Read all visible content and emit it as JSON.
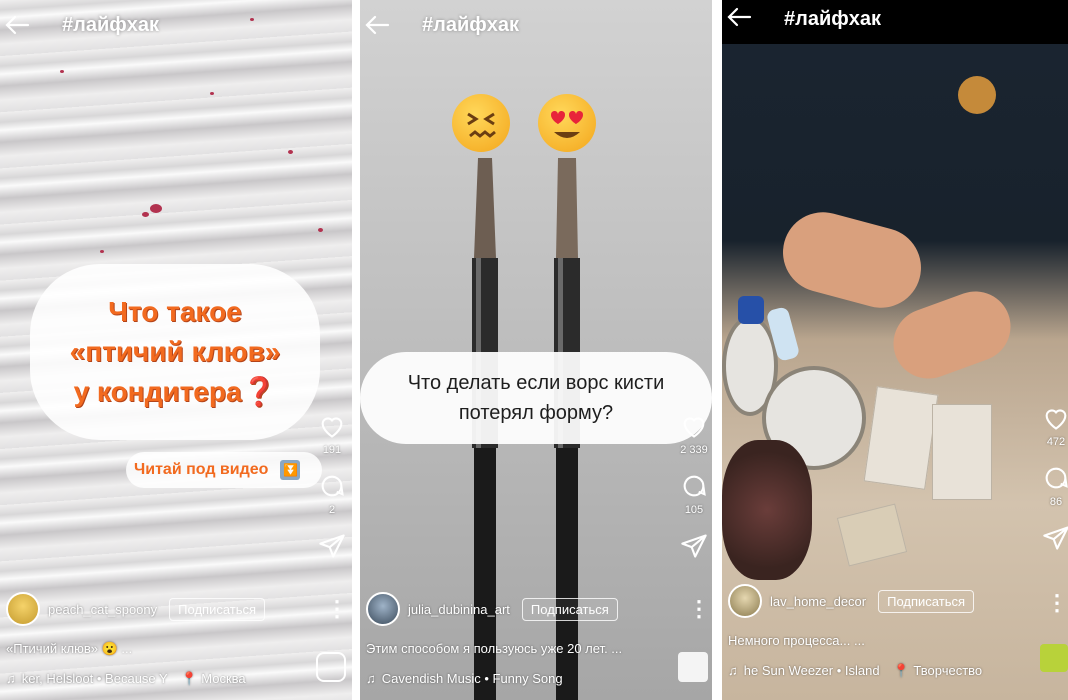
{
  "panels": [
    {
      "title": "#лайфхак",
      "overlay_lines": [
        "Что такое",
        "«птичий клюв»",
        "у кондитера❓"
      ],
      "chip": "Читай под видео",
      "likes": "191",
      "comments": "2",
      "username": "peach_cat_spoony",
      "subscribe": "Подписаться",
      "caption": "«Птичий клюв» 😮 ...",
      "music": "ker, Helsloot • Because Y",
      "location": "Москва"
    },
    {
      "title": "#лайфхак",
      "overlay_lines": [
        "Что делать если ворс кисти",
        "потерял форму?"
      ],
      "likes": "2 339",
      "comments": "105",
      "username": "julia_dubinina_art",
      "subscribe": "Подписаться",
      "caption": "Этим способом я пользуюсь уже 20 лет. ...",
      "music": "Cavendish Music • Funny Song"
    },
    {
      "title": "#лайфхак",
      "likes": "472",
      "comments": "86",
      "username": "lav_home_decor",
      "subscribe": "Подписаться",
      "caption": "Немного процесса... ...",
      "music": "he Sun   Weezer • Island",
      "location": "Творчество"
    }
  ],
  "icons": {
    "back": "arrow-left-icon",
    "like": "heart-icon",
    "comment": "comment-icon",
    "share": "send-icon",
    "more": "more-vertical-icon",
    "music": "music-note-icon",
    "location": "location-pin-icon",
    "gallery": "gallery-icon"
  },
  "colors": {
    "overlay_text": "#f26a1f",
    "white": "#ffffff"
  }
}
